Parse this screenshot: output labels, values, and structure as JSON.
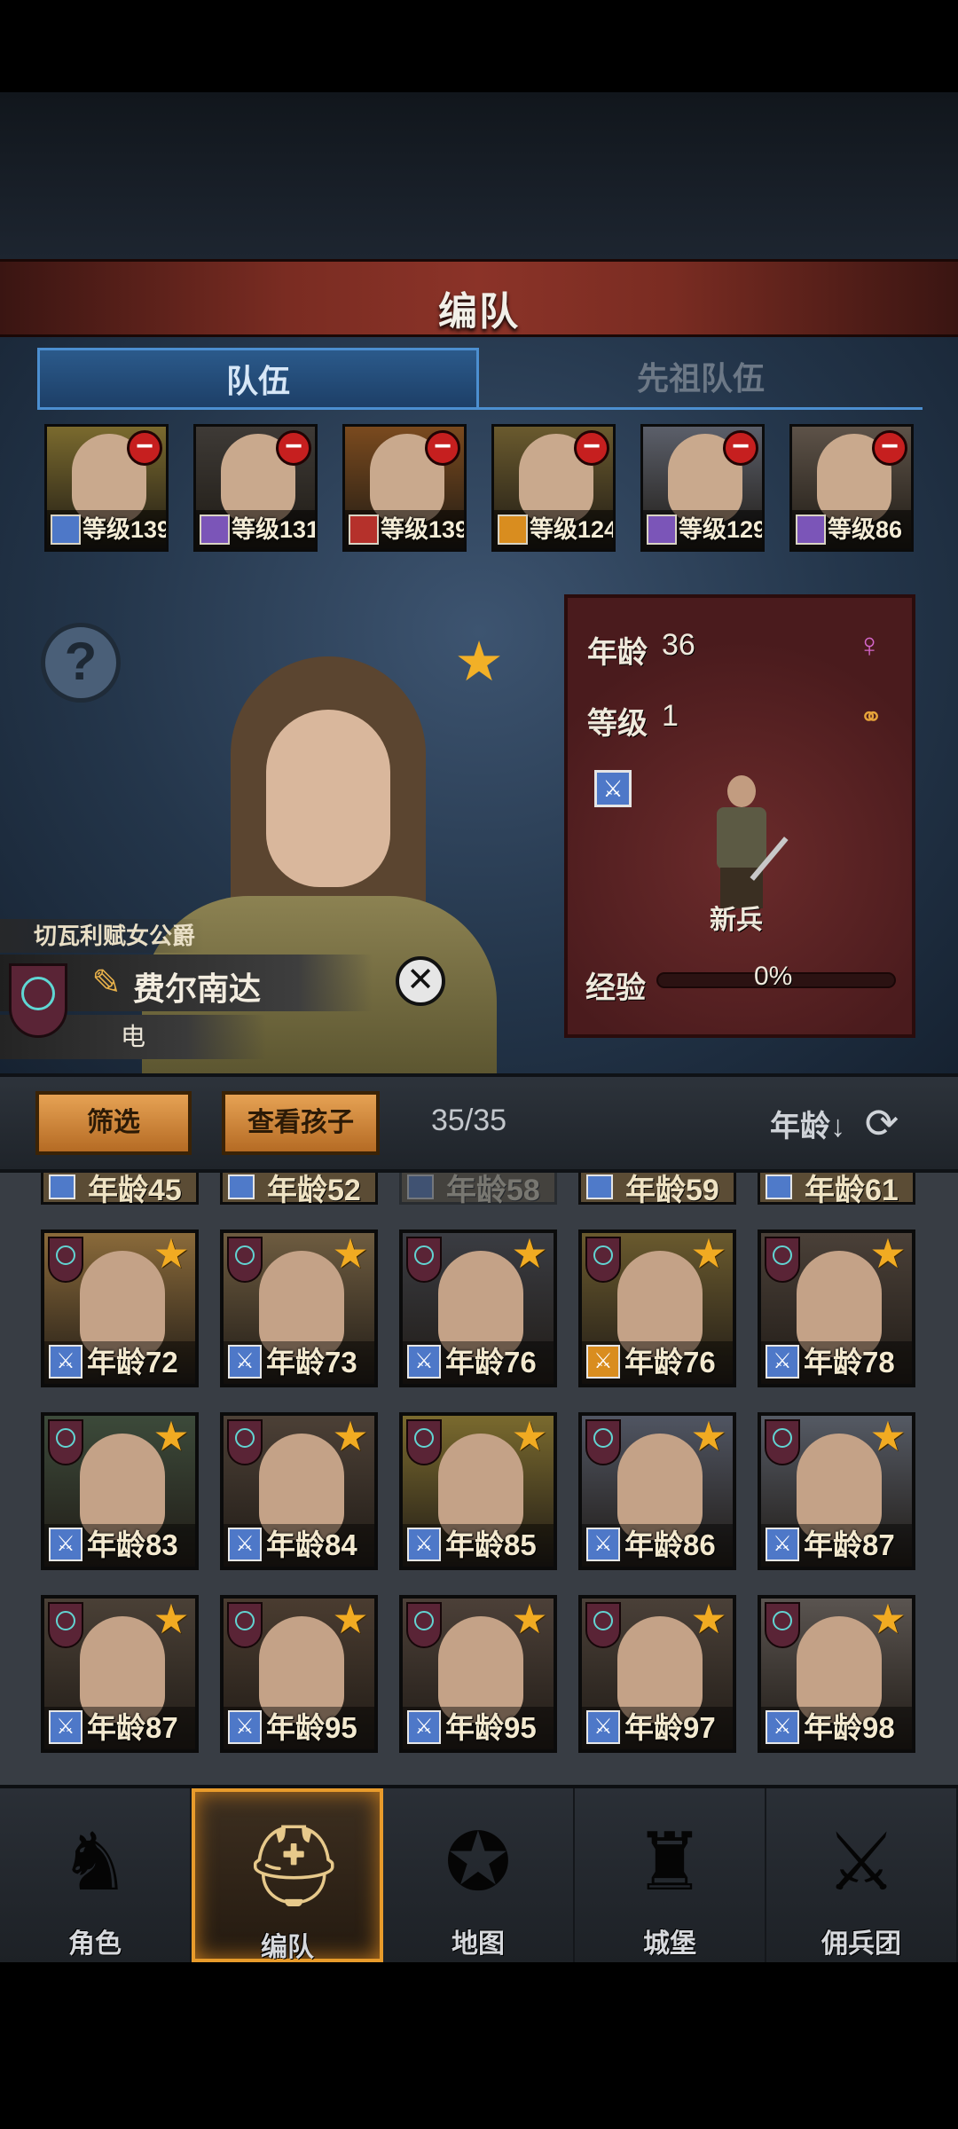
{
  "header": {
    "title": "编队"
  },
  "tabs": [
    {
      "label": "队伍",
      "active": true
    },
    {
      "label": "先祖队伍",
      "active": false
    }
  ],
  "roster": [
    {
      "level_text": "等级139",
      "class_color": "#4e78c8",
      "bg": "#7a6a2e"
    },
    {
      "level_text": "等级131",
      "class_color": "#7b55b8",
      "bg": "#3e3a36"
    },
    {
      "level_text": "等级139",
      "class_color": "#b5312b",
      "bg": "#7a4a1e"
    },
    {
      "level_text": "等级124",
      "class_color": "#d98d1f",
      "bg": "#6a5a2e"
    },
    {
      "level_text": "等级129",
      "class_color": "#7b55b8",
      "bg": "#5b5f6a"
    },
    {
      "level_text": "等级86",
      "class_color": "#7b55b8",
      "bg": "#5d5248"
    }
  ],
  "character": {
    "house": "切瓦利赋女公爵",
    "name": "费尔南达",
    "trait": "电",
    "age_label": "年龄",
    "age_value": "36",
    "level_label": "等级",
    "level_value": "1",
    "rank": "新兵",
    "xp_label": "经验",
    "xp_value": "0%",
    "xp_fraction": 0
  },
  "filter_bar": {
    "filter_label": "筛选",
    "children_label": "查看孩子",
    "count": "35/35",
    "sort_label": "年龄↓"
  },
  "partial_row": [
    {
      "label": "年龄45",
      "dim": false
    },
    {
      "label": "年龄52",
      "dim": false
    },
    {
      "label": "年龄58",
      "dim": true
    },
    {
      "label": "年龄59",
      "dim": false
    },
    {
      "label": "年龄61",
      "dim": false
    }
  ],
  "grid": [
    {
      "age": "年龄72",
      "class_color": "#4e78c8",
      "bg": "#8a6a3a"
    },
    {
      "age": "年龄73",
      "class_color": "#4e78c8",
      "bg": "#6e5c40"
    },
    {
      "age": "年龄76",
      "class_color": "#4e78c8",
      "bg": "#3a3c42"
    },
    {
      "age": "年龄76",
      "class_color": "#d98d1f",
      "bg": "#6a5a2e"
    },
    {
      "age": "年龄78",
      "class_color": "#4e78c8",
      "bg": "#4a4038"
    },
    {
      "age": "年龄83",
      "class_color": "#4e78c8",
      "bg": "#3c4a3a"
    },
    {
      "age": "年龄84",
      "class_color": "#4e78c8",
      "bg": "#4c4036"
    },
    {
      "age": "年龄85",
      "class_color": "#4e78c8",
      "bg": "#7a6a2e"
    },
    {
      "age": "年龄86",
      "class_color": "#4e78c8",
      "bg": "#505562"
    },
    {
      "age": "年龄87",
      "class_color": "#4e78c8",
      "bg": "#555a64"
    },
    {
      "age": "年龄87",
      "class_color": "#4e78c8",
      "bg": "#4a4036"
    },
    {
      "age": "年龄95",
      "class_color": "#4e78c8",
      "bg": "#4a3c30"
    },
    {
      "age": "年龄95",
      "class_color": "#4e78c8",
      "bg": "#4c4038"
    },
    {
      "age": "年龄97",
      "class_color": "#4e78c8",
      "bg": "#4a4038"
    },
    {
      "age": "年龄98",
      "class_color": "#4e78c8",
      "bg": "#5a5450"
    }
  ],
  "nav": [
    {
      "label": "角色",
      "icon": "knight-icon",
      "active": false
    },
    {
      "label": "编队",
      "icon": "helmet-icon",
      "active": true
    },
    {
      "label": "地图",
      "icon": "compass-map-icon",
      "active": false
    },
    {
      "label": "城堡",
      "icon": "castle-icon",
      "active": false
    },
    {
      "label": "佣兵团",
      "icon": "mercenary-icon",
      "active": false
    }
  ],
  "colors": {
    "accent": "#e89b2b",
    "tab_blue": "#4c8fd0",
    "remove_red": "#c61f1f",
    "star": "#f1ab22"
  }
}
